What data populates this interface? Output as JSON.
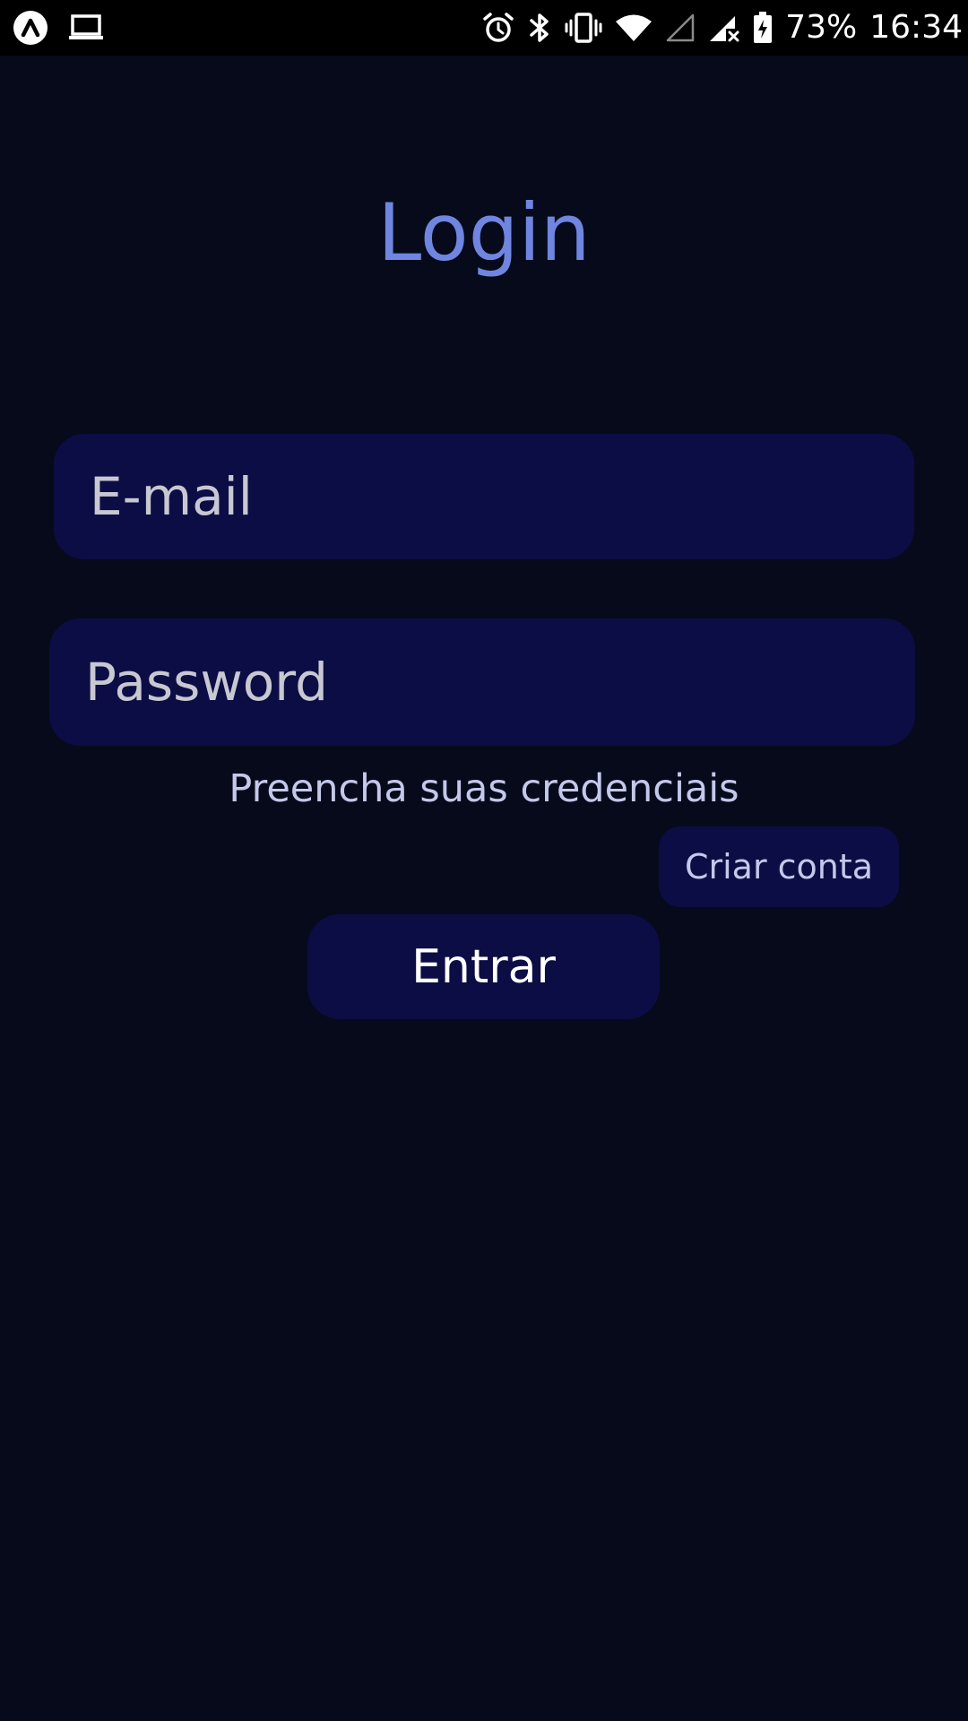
{
  "status_bar": {
    "left_icons": [
      "app-launcher-icon",
      "laptop-icon"
    ],
    "right_icons": [
      "alarm-icon",
      "bluetooth-icon",
      "vibrate-icon",
      "wifi-icon",
      "signal-empty-icon",
      "signal-no-service-icon",
      "battery-charging-icon"
    ],
    "battery_percent": "73%",
    "time": "16:34"
  },
  "login": {
    "title": "Login",
    "email_placeholder": "E-mail",
    "password_placeholder": "Password",
    "hint": "Preencha suas credenciais",
    "create_account_label": "Criar conta",
    "enter_label": "Entrar"
  },
  "colors": {
    "background": "#070a1a",
    "title": "#6f85e0",
    "field_background": "#0d0d45",
    "placeholder": "#c8c8d2",
    "hint": "#c4c8ea"
  }
}
